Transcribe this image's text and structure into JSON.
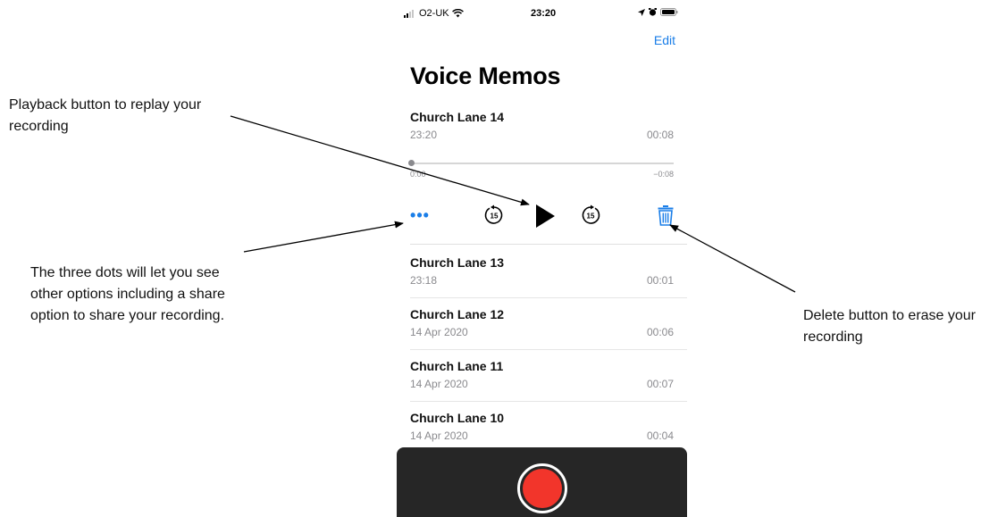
{
  "status_bar": {
    "carrier": "O2-UK",
    "time": "23:20"
  },
  "nav": {
    "edit_label": "Edit",
    "title": "Voice Memos"
  },
  "selected_memo": {
    "name": "Church Lane 14",
    "date": "23:20",
    "duration": "00:08",
    "elapsed": "0:00",
    "remaining": "−0:08",
    "progress": 0
  },
  "controls": {
    "more_label": "•••",
    "skip_back_label": "15",
    "skip_forward_label": "15"
  },
  "memos": [
    {
      "name": "Church Lane 13",
      "date": "23:18",
      "duration": "00:01"
    },
    {
      "name": "Church Lane 12",
      "date": "14 Apr 2020",
      "duration": "00:06"
    },
    {
      "name": "Church Lane 11",
      "date": "14 Apr 2020",
      "duration": "00:07"
    },
    {
      "name": "Church Lane 10",
      "date": "14 Apr 2020",
      "duration": "00:04"
    }
  ],
  "annotations": {
    "playback": "Playback button to replay your recording",
    "more": "The three dots will let you see other options including a share option to share your recording.",
    "delete": "Delete button to erase your recording"
  },
  "colors": {
    "accent": "#1a7ee8",
    "record": "#f2352b",
    "panel": "#262626",
    "secondary_text": "#8a8a8e"
  },
  "icons": {
    "skip_back": "skip-back-15-icon",
    "play": "play-icon",
    "skip_forward": "skip-forward-15-icon",
    "delete": "trash-icon",
    "record": "record-icon"
  }
}
